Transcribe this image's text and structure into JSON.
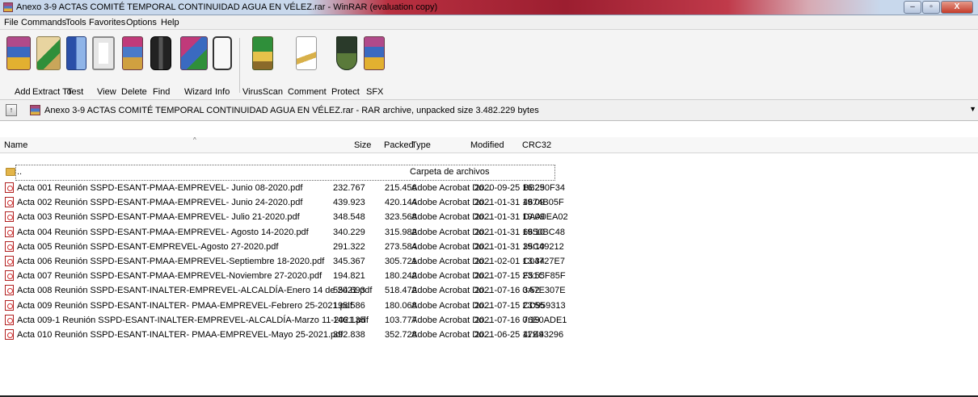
{
  "window": {
    "title": "Anexo 3-9  ACTAS COMITÉ TEMPORAL CONTINUIDAD AGUA EN VÉLEZ.rar - WinRAR (evaluation copy)",
    "minimize": "–",
    "maximize": "▫",
    "close": "X"
  },
  "menu": [
    "File",
    "Commands",
    "Tools",
    "Favorites",
    "Options",
    "Help"
  ],
  "toolbar": [
    {
      "label": "Add",
      "icon": "add-icon"
    },
    {
      "label": "Extract To",
      "icon": "extract-to-icon"
    },
    {
      "label": "Test",
      "icon": "test-icon"
    },
    {
      "label": "View",
      "icon": "view-icon"
    },
    {
      "label": "Delete",
      "icon": "delete-icon"
    },
    {
      "label": "Find",
      "icon": "find-icon"
    },
    {
      "label": "Wizard",
      "icon": "wizard-icon"
    },
    {
      "label": "Info",
      "icon": "info-icon"
    },
    {
      "label": "VirusScan",
      "icon": "virusscan-icon"
    },
    {
      "label": "Comment",
      "icon": "comment-icon"
    },
    {
      "label": "Protect",
      "icon": "protect-icon"
    },
    {
      "label": "SFX",
      "icon": "sfx-icon"
    }
  ],
  "address": {
    "text": "Anexo 3-9  ACTAS COMITÉ TEMPORAL CONTINUIDAD AGUA EN VÉLEZ.rar - RAR archive, unpacked size 3.482.229 bytes"
  },
  "columns": {
    "name": "Name",
    "size": "Size",
    "packed": "Packed",
    "type": "Type",
    "modified": "Modified",
    "crc": "CRC32"
  },
  "parent_row": {
    "name": "..",
    "type": "Carpeta de archivos"
  },
  "files": [
    {
      "name": "Acta 001 Reunión SSPD-ESANT-PMAA-EMPREVEL- Junio 08-2020.pdf",
      "size": "232.767",
      "packed": "215.456",
      "type": "Adobe Acrobat Do...",
      "modified": "2020-09-25 16:25",
      "crc": "BB290F34"
    },
    {
      "name": "Acta 002 Reunión SSPD-ESANT-PMAA-EMPREVEL- Junio 24-2020.pdf",
      "size": "439.923",
      "packed": "420.144",
      "type": "Adobe Acrobat Do...",
      "modified": "2021-01-31 19:09",
      "crc": "4674B05F"
    },
    {
      "name": "Acta 003 Reunión SSPD-ESANT-PMAA-EMPREVEL- Julio 21-2020.pdf",
      "size": "348.548",
      "packed": "323.568",
      "type": "Adobe Acrobat Do...",
      "modified": "2021-01-31 19:09",
      "crc": "DAA0EA02"
    },
    {
      "name": "Acta 004 Reunión SSPD-ESANT-PMAA-EMPREVEL- Agosto 14-2020.pdf",
      "size": "340.229",
      "packed": "315.982",
      "type": "Adobe Acrobat Do...",
      "modified": "2021-01-31 19:10",
      "crc": "6650BC48"
    },
    {
      "name": "Acta 005 Reunión SSPD-ESANT-EMPREVEL-Agosto 27-2020.pdf",
      "size": "291.322",
      "packed": "273.584",
      "type": "Adobe Acrobat Do...",
      "modified": "2021-01-31 19:10",
      "crc": "35C49212"
    },
    {
      "name": "Acta 006 Reunión SSPD-ESANT-PMAA-EMPREVEL-Septiembre 18-2020.pdf",
      "size": "345.367",
      "packed": "305.721",
      "type": "Adobe Acrobat Do...",
      "modified": "2021-02-01 13:34",
      "crc": "C04727E7"
    },
    {
      "name": "Acta 007 Reunión SSPD-ESANT-PMAA-EMPREVEL-Noviembre 27-2020.pdf",
      "size": "194.821",
      "packed": "180.242",
      "type": "Adobe Acrobat Do...",
      "modified": "2021-07-15 23:55",
      "crc": "F51CF85F"
    },
    {
      "name": "Acta 008 Reunión SSPD-ESANT-INALTER-EMPREVEL-ALCALDÍA-Enero 14 de 2021.pdf",
      "size": "554.693",
      "packed": "518.472",
      "type": "Adobe Acrobat Do...",
      "modified": "2021-07-16 0:52",
      "crc": "3A7E307E"
    },
    {
      "name": "Acta 009 Reunión SSPD-ESANT-INALTER- PMAA-EMPREVEL-Febrero 25-2021.pdf",
      "size": "195.586",
      "packed": "180.068",
      "type": "Adobe Acrobat Do...",
      "modified": "2021-07-15 23:55",
      "crc": "CD959313"
    },
    {
      "name": "Acta 009-1 Reunión SSPD-ESANT-INALTER-EMPREVEL-ALCALDÍA-Marzo 11-2021.pdf",
      "size": "146.135",
      "packed": "103.777",
      "type": "Adobe Acrobat Do...",
      "modified": "2021-07-16 0:19",
      "crc": "76E0ADE1"
    },
    {
      "name": "Acta 010 Reunión SSPD-ESANT-INALTER- PMAA-EMPREVEL-Mayo 25-2021.pdf",
      "size": "392.838",
      "packed": "352.728",
      "type": "Adobe Acrobat Do...",
      "modified": "2021-06-25 11:44",
      "crc": "47E93296"
    }
  ]
}
